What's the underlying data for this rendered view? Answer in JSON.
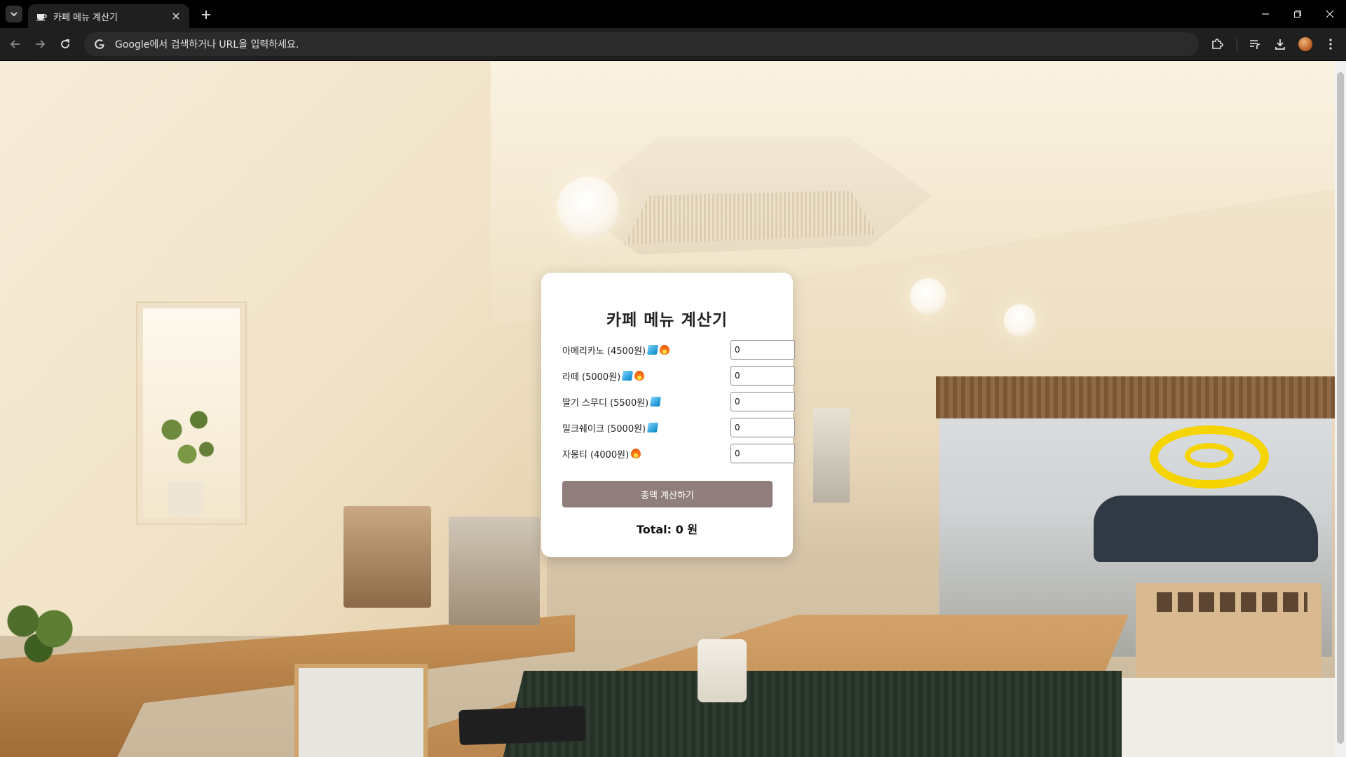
{
  "browser": {
    "tab_title": "카페 메뉴 계산기",
    "omnibox_placeholder": "Google에서 검색하거나 URL을 입력하세요.",
    "new_tab_label": "+"
  },
  "card": {
    "title": "카페 메뉴 계산기",
    "items": [
      {
        "label": "아메리카노 (4500원)",
        "icons": [
          "ice-cube-icon",
          "fire-icon"
        ],
        "quantity": "0"
      },
      {
        "label": "라떼 (5000원)",
        "icons": [
          "ice-cube-icon",
          "fire-icon"
        ],
        "quantity": "0"
      },
      {
        "label": "딸기 스무디 (5500원)",
        "icons": [
          "ice-cube-icon"
        ],
        "quantity": "0"
      },
      {
        "label": "밀크쉐이크 (5000원)",
        "icons": [
          "ice-cube-icon"
        ],
        "quantity": "0"
      },
      {
        "label": "자몽티 (4000원)",
        "icons": [
          "fire-icon"
        ],
        "quantity": "0"
      }
    ],
    "button_label": "총액 계산하기",
    "total_text": "Total: 0 원"
  },
  "colors": {
    "button_bg": "#8f7e7b",
    "card_bg": "#ffffff",
    "chrome_bg": "#1f1f1f"
  }
}
